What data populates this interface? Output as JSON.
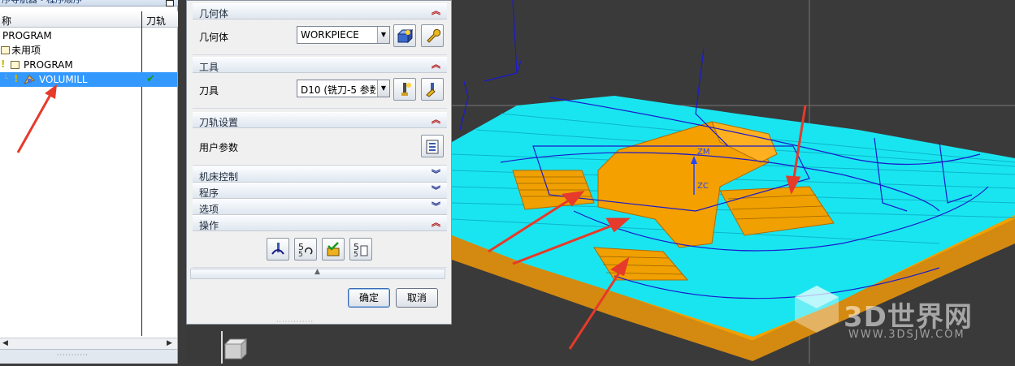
{
  "navigator": {
    "title": "序导航器 - 程序顺序",
    "col_name": "称",
    "col_toolpath": "刀轨",
    "items": [
      {
        "label": "PROGRAM"
      },
      {
        "label": "未用项"
      },
      {
        "label": "PROGRAM"
      },
      {
        "label": "VOLUMILL",
        "selected": true,
        "toolpath_ok": "✔"
      }
    ]
  },
  "dialog": {
    "geometry": {
      "header": "几何体",
      "label": "几何体",
      "value": "WORKPIECE"
    },
    "tool": {
      "header": "工具",
      "label": "刀具",
      "value": "D10 (铣刀-5 参数"
    },
    "toolpath_settings": {
      "header": "刀轨设置",
      "user_params_label": "用户参数"
    },
    "collapsed_sections": [
      "机床控制",
      "程序",
      "选项"
    ],
    "operations": {
      "header": "操作"
    },
    "ok_label": "确定",
    "cancel_label": "取消"
  },
  "viewport": {
    "axis_labels": {
      "zm": "ZM",
      "zc": "ZC"
    },
    "watermark": {
      "text": "3D世界网",
      "url": "WWW.3DSJW.COM"
    }
  },
  "colors": {
    "selection": "#3399ff",
    "toolpath_cyan": "#19e5f0",
    "part_orange": "#f0a000",
    "toolpath_blue": "#1a1acc",
    "arrow_red": "#e63a2a"
  }
}
